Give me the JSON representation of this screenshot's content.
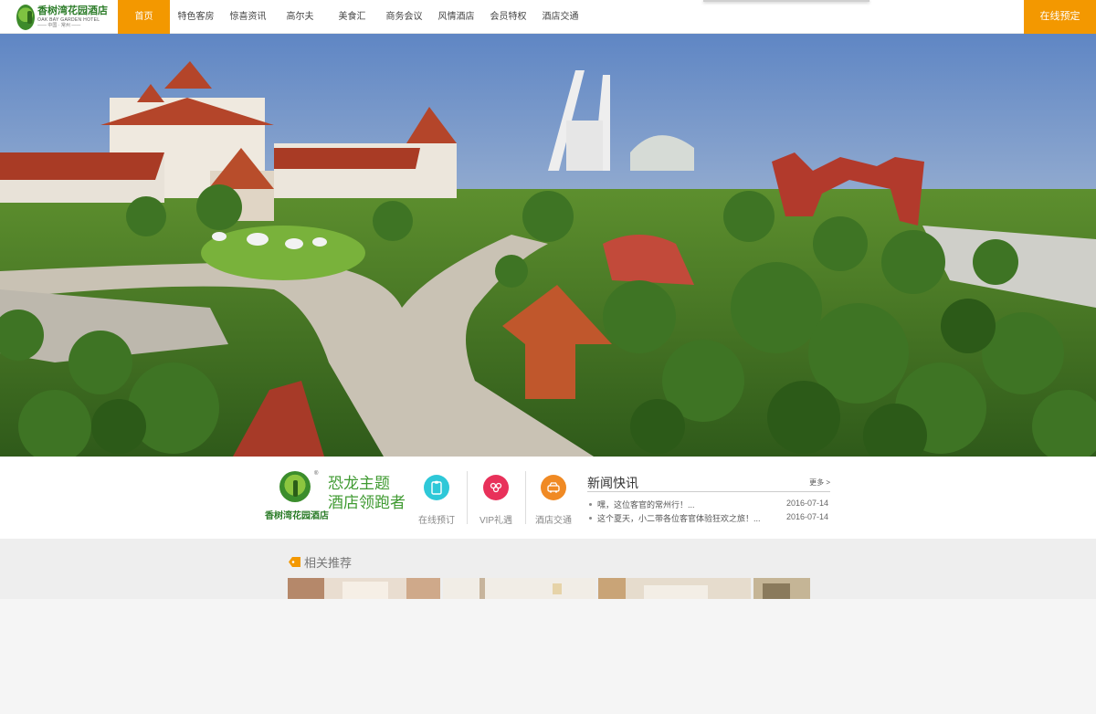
{
  "header": {
    "logo": {
      "cn": "香树湾花园酒店",
      "en": "OAK BAY GARDEN HOTEL",
      "sub": "—— 中国 · 常州 ——"
    },
    "nav": [
      {
        "label": "首页",
        "active": true
      },
      {
        "label": "特色客房",
        "active": false
      },
      {
        "label": "惊喜资讯",
        "active": false
      },
      {
        "label": "高尔夫",
        "active": false
      },
      {
        "label": "美食汇",
        "active": false
      },
      {
        "label": "商务会议",
        "active": false
      },
      {
        "label": "风情酒店",
        "active": false
      },
      {
        "label": "会员特权",
        "active": false
      },
      {
        "label": "酒店交通",
        "active": false
      }
    ],
    "book_label": "在线预定"
  },
  "info": {
    "brand_cn": "香树湾花园酒店",
    "brand_reg": "®",
    "slogan_line1": "恐龙主题",
    "slogan_line2": "酒店领跑者",
    "services": [
      {
        "label": "在线预订",
        "icon": "clipboard-icon",
        "color": "#2ec8d8"
      },
      {
        "label": "VIP礼遇",
        "icon": "people-icon",
        "color": "#e8315a"
      },
      {
        "label": "酒店交通",
        "icon": "car-icon",
        "color": "#f08a24"
      }
    ]
  },
  "news": {
    "title": "新闻快讯",
    "more": "更多 >",
    "items": [
      {
        "text": "嘿，这位客官的常州行！...",
        "date": "2016-07-14"
      },
      {
        "text": "这个夏天，小二带各位客官体验狂欢之旅！...",
        "date": "2016-07-14"
      }
    ]
  },
  "related": {
    "title": "相关推荐"
  },
  "colors": {
    "accent": "#f39800",
    "green": "#3f9a31"
  }
}
